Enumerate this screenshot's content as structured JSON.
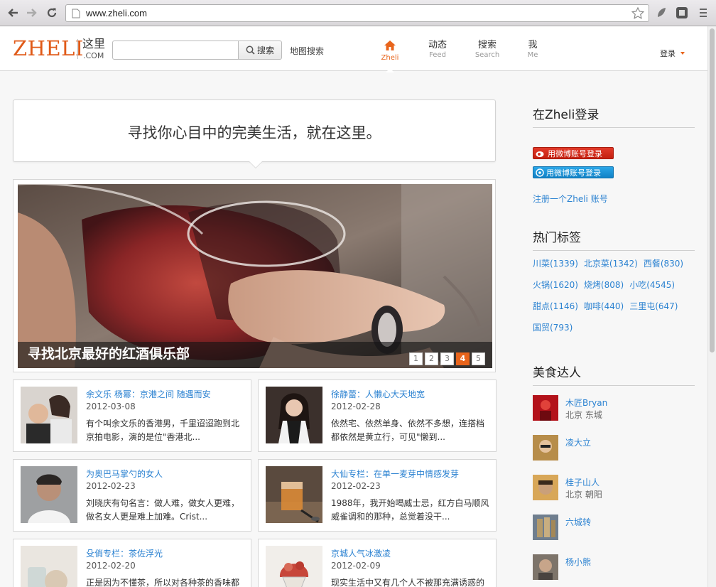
{
  "browser": {
    "url": "www.zheli.com"
  },
  "header": {
    "logo_en": "ZHELI",
    "logo_cn": "这里",
    "logo_com": ".COM",
    "search_placeholder": "",
    "search_button": "搜索",
    "map_search": "地图搜索",
    "tabs": [
      {
        "cn": "",
        "en": "Zheli",
        "icon": "home-icon",
        "active": true
      },
      {
        "cn": "动态",
        "en": "Feed",
        "active": false
      },
      {
        "cn": "搜索",
        "en": "Search",
        "active": false
      },
      {
        "cn": "我",
        "en": "Me",
        "active": false
      }
    ],
    "login": "登录"
  },
  "banner": {
    "tagline": "寻找你心目中的完美生活，就在这里。"
  },
  "slider": {
    "caption": "寻找北京最好的红酒俱乐部",
    "pages": [
      "1",
      "2",
      "3",
      "4",
      "5"
    ],
    "active_page": "4"
  },
  "cards": [
    {
      "title": "余文乐 杨幂：京港之间 随遇而安",
      "date": "2012-03-08",
      "desc": "有个叫余文乐的香港男，千里迢迢跑到北京拍电影，演的是位\"香港北..."
    },
    {
      "title": "徐静蕾：人懒心大天地宽",
      "date": "2012-02-28",
      "desc": "依然宅、依然单身、依然不多想，连搭档都依然是黄立行，可见\"懒到..."
    },
    {
      "title": "为奥巴马掌勺的女人",
      "date": "2012-02-23",
      "desc": "刘晓庆有句名言：做人难，做女人更难，做名女人更是难上加难。Crist..."
    },
    {
      "title": "大仙专栏：在单一麦芽中情感发芽",
      "date": "2012-02-23",
      "desc": "1988年，我开始喝威士忌，红方白马顺风威雀调和的那种，总觉着没干..."
    },
    {
      "title": "殳俏专栏：茶佐浮光",
      "date": "2012-02-20",
      "desc": "正是因为不懂茶，所以对各种茶的香味都"
    },
    {
      "title": "京城人气冰激凌",
      "date": "2012-02-09",
      "desc": "现实生活中又有几个人不被那充满诱惑的"
    }
  ],
  "sidebar": {
    "login_title": "在Zheli登录",
    "weibo_login": "用微博账号登录",
    "tqq_login": "用微博账号登录",
    "register": "注册一个Zheli 账号",
    "tags_title": "热门标签",
    "tags": [
      [
        "川菜(1339)",
        "北京菜(1342)",
        "西餐(830)"
      ],
      [
        "火锅(1620)",
        "烧烤(808)",
        "小吃(4545)"
      ],
      [
        "甜点(1146)",
        "咖啡(440)",
        "三里屯(647)"
      ],
      [
        "国贸(793)"
      ]
    ],
    "experts_title": "美食达人",
    "experts": [
      {
        "name": "木匠Bryan",
        "loc": "北京 东城"
      },
      {
        "name": "凌大立",
        "loc": ""
      },
      {
        "name": "桂子山人",
        "loc": "北京 朝阳"
      },
      {
        "name": "六城转",
        "loc": ""
      },
      {
        "name": "杨小熊",
        "loc": ""
      }
    ]
  },
  "colors": {
    "brand": "#e05a18",
    "link": "#2b82d1",
    "weibo": "#d42d1c",
    "tqq": "#1f94d6"
  }
}
